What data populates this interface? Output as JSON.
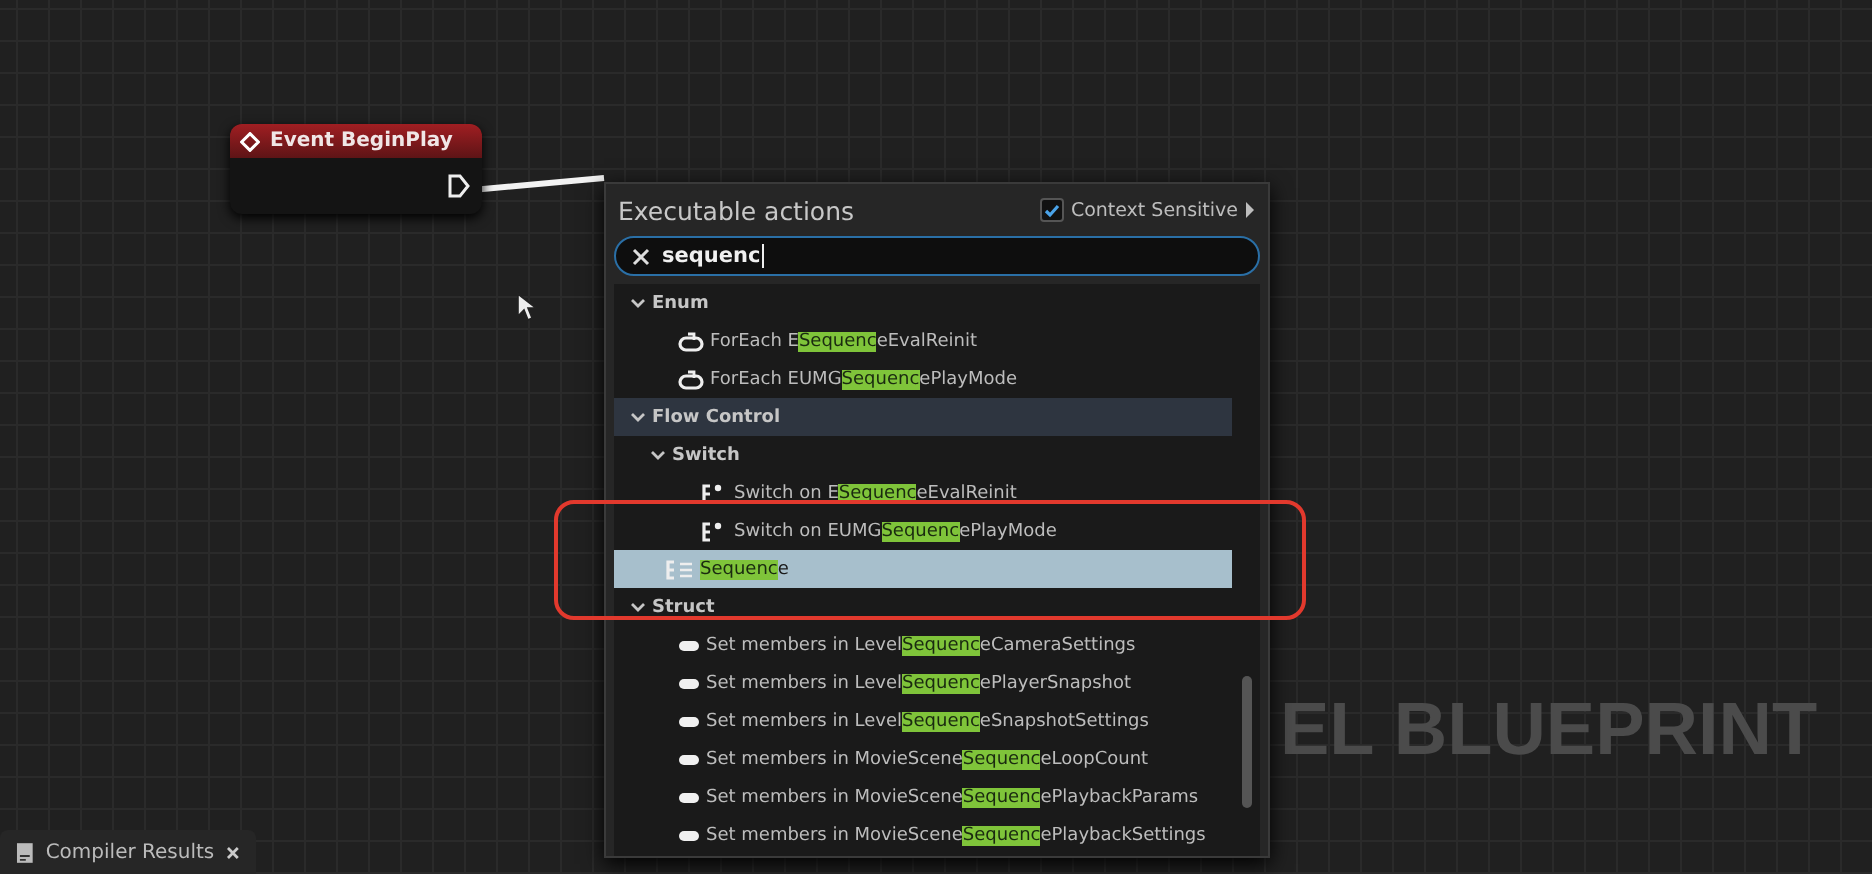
{
  "graph_node": {
    "title": "Event BeginPlay"
  },
  "graph_label": "EL BLUEPRINT",
  "action_menu": {
    "title": "Executable actions",
    "context_sensitive": {
      "label": "Context Sensitive",
      "checked": true
    },
    "search": {
      "value": "sequenc"
    },
    "results": [
      {
        "label": "Enum",
        "expanded": true,
        "hovered": false,
        "children": [
          {
            "kind": "foreach",
            "before": "ForEach E",
            "match": "Sequenc",
            "after": "eEvalReinit",
            "selected": false
          },
          {
            "kind": "foreach",
            "before": "ForEach EUMG",
            "match": "Sequenc",
            "after": "ePlayMode",
            "selected": false
          }
        ]
      },
      {
        "label": "Flow Control",
        "expanded": true,
        "hovered": true,
        "children": [
          {
            "label": "Switch",
            "expanded": true,
            "hovered": false,
            "children": [
              {
                "kind": "switch",
                "before": "Switch on E",
                "match": "Sequenc",
                "after": "eEvalReinit",
                "selected": false
              },
              {
                "kind": "switch",
                "before": "Switch on EUMG",
                "match": "Sequenc",
                "after": "ePlayMode",
                "selected": false
              }
            ]
          },
          {
            "kind": "sequence",
            "match": "Sequenc",
            "after": "e",
            "selected": true
          }
        ]
      },
      {
        "label": "Struct",
        "expanded": true,
        "hovered": false,
        "children": [
          {
            "kind": "struct",
            "before": "Set members in Level",
            "match": "Sequenc",
            "after": "eCameraSettings",
            "selected": false
          },
          {
            "kind": "struct",
            "before": "Set members in Level",
            "match": "Sequenc",
            "after": "ePlayerSnapshot",
            "selected": false
          },
          {
            "kind": "struct",
            "before": "Set members in Level",
            "match": "Sequenc",
            "after": "eSnapshotSettings",
            "selected": false
          },
          {
            "kind": "struct",
            "before": "Set members in MovieScene",
            "match": "Sequenc",
            "after": "eLoopCount",
            "selected": false
          },
          {
            "kind": "struct",
            "before": "Set members in MovieScene",
            "match": "Sequenc",
            "after": "ePlaybackParams",
            "selected": false
          },
          {
            "kind": "struct",
            "before": "Set members in MovieScene",
            "match": "Sequenc",
            "after": "ePlaybackSettings",
            "selected": false
          }
        ]
      }
    ]
  },
  "bottom_tab": {
    "label": "Compiler Results"
  }
}
